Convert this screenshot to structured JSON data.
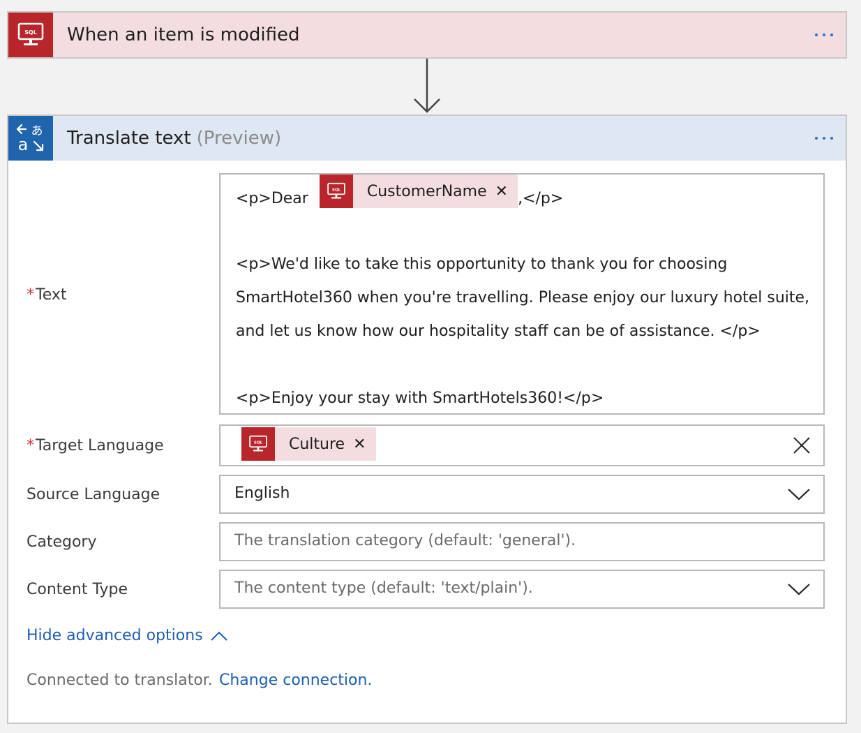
{
  "trigger": {
    "title": "When an item is modified",
    "icon": "sql-server-icon",
    "icon_text": "SQL",
    "color": "#b8262b"
  },
  "action": {
    "title": "Translate text",
    "title_suffix": "(Preview)",
    "icon": "translator-icon",
    "icon_glyphs": "あ",
    "color": "#2064ad"
  },
  "fields": {
    "text": {
      "label": "Text",
      "required": "*",
      "line1_prefix": "<p>Dear",
      "token": "CustomerName",
      "token_close": "✕",
      "line1_suffix": ",</p>",
      "line2": "<p>We'd like to take this opportunity to thank you for choosing",
      "line3": "SmartHotel360 when you're travelling. Please enjoy our luxury hotel suite,",
      "line4": "and let us know how our hospitality staff can be of assistance. </p>",
      "line5": "<p>Enjoy your stay with SmartHotels360!</p>"
    },
    "target_language": {
      "label": "Target Language",
      "required": "*",
      "token": "Culture",
      "token_close": "✕"
    },
    "source_language": {
      "label": "Source Language",
      "value": "English"
    },
    "category": {
      "label": "Category",
      "placeholder": "The translation category (default: 'general')."
    },
    "content_type": {
      "label": "Content Type",
      "placeholder": "The content type (default: 'text/plain')."
    }
  },
  "advanced_toggle": "Hide advanced options",
  "footer": {
    "connected": "Connected to translator.",
    "change_link": "Change connection."
  }
}
